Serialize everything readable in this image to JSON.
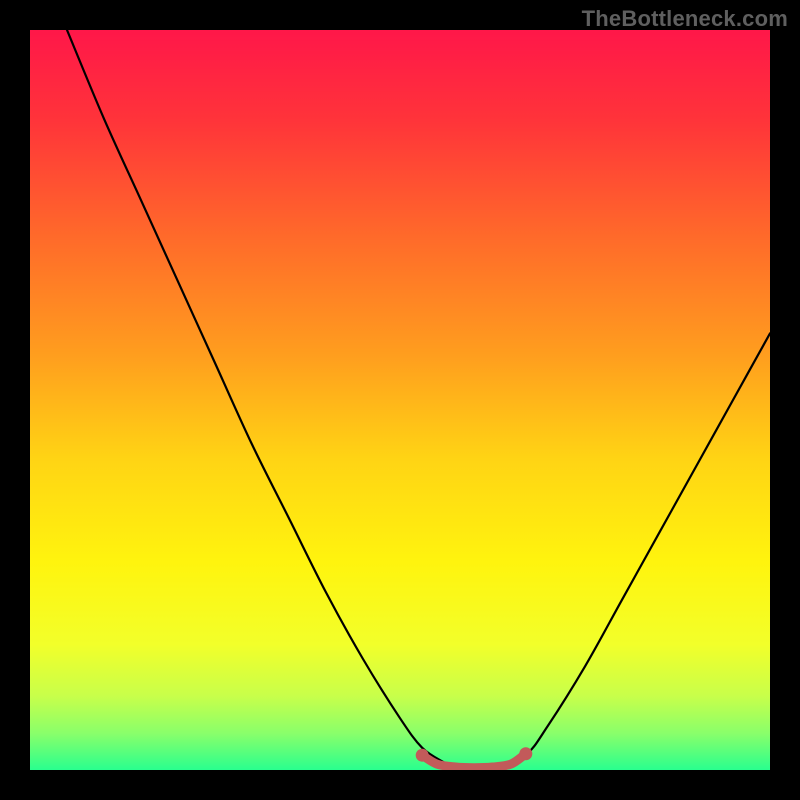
{
  "watermark": "TheBottleneck.com",
  "chart_data": {
    "type": "line",
    "title": "",
    "xlabel": "",
    "ylabel": "",
    "xlim": [
      0,
      100
    ],
    "ylim": [
      0,
      100
    ],
    "grid": false,
    "legend": false,
    "gradient_stops": [
      {
        "offset": 0.0,
        "color": "#ff1749"
      },
      {
        "offset": 0.12,
        "color": "#ff333a"
      },
      {
        "offset": 0.28,
        "color": "#ff6a2a"
      },
      {
        "offset": 0.44,
        "color": "#ff9e1e"
      },
      {
        "offset": 0.58,
        "color": "#ffd414"
      },
      {
        "offset": 0.72,
        "color": "#fff40e"
      },
      {
        "offset": 0.83,
        "color": "#f2ff2a"
      },
      {
        "offset": 0.9,
        "color": "#c8ff4a"
      },
      {
        "offset": 0.95,
        "color": "#8aff6a"
      },
      {
        "offset": 1.0,
        "color": "#29ff8e"
      }
    ],
    "series": [
      {
        "name": "bottleneck-curve",
        "color": "#000000",
        "x": [
          5,
          10,
          15,
          20,
          25,
          30,
          35,
          40,
          45,
          50,
          53,
          56,
          58,
          60,
          63,
          67,
          70,
          75,
          80,
          85,
          90,
          95,
          100
        ],
        "y": [
          100,
          88,
          77,
          66,
          55,
          44,
          34,
          24,
          15,
          7,
          3,
          1,
          0,
          0,
          0,
          2,
          6,
          14,
          23,
          32,
          41,
          50,
          59
        ]
      }
    ],
    "flat_zone": {
      "color": "#c25a5a",
      "x": [
        53,
        55,
        57.5,
        60,
        62.5,
        65,
        67
      ],
      "y": [
        2.0,
        0.8,
        0.4,
        0.3,
        0.4,
        0.8,
        2.2
      ]
    },
    "flat_zone_endpoints": [
      {
        "x": 53,
        "y": 2.0
      },
      {
        "x": 67,
        "y": 2.2
      }
    ]
  }
}
